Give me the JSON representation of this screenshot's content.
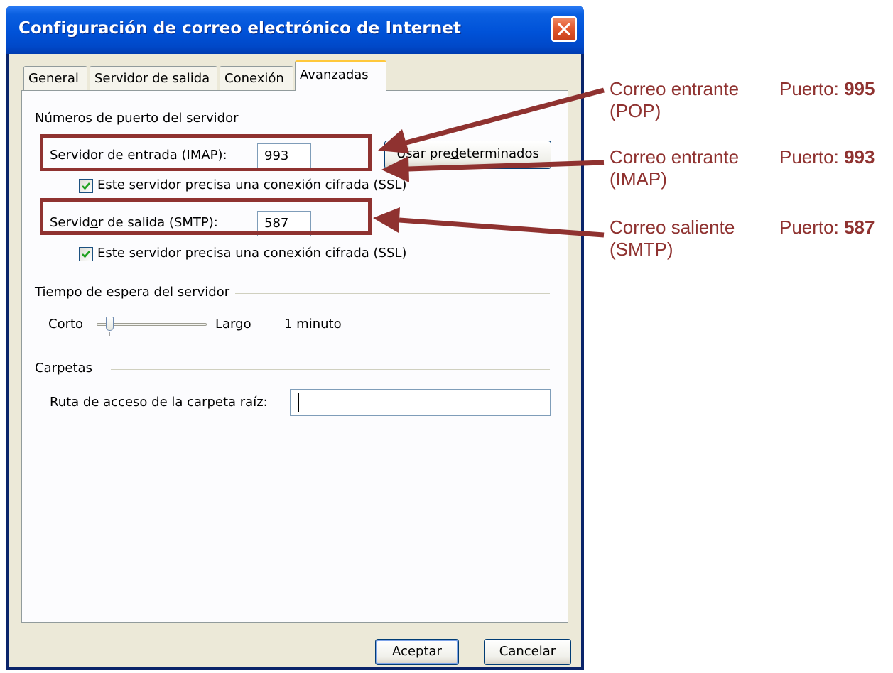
{
  "window": {
    "title": "Configuración de correo electrónico de Internet",
    "close_icon": "close-icon"
  },
  "tabs": [
    {
      "label": "General",
      "active": false
    },
    {
      "label": "Servidor de salida",
      "active": false
    },
    {
      "label": "Conexión",
      "active": false
    },
    {
      "label": "Avanzadas",
      "active": true
    }
  ],
  "ports_section": {
    "title": "Números de puerto del servidor",
    "incoming": {
      "label_pre": "Servi",
      "label_u": "d",
      "label_post": "or de entrada (IMAP):",
      "value": "993"
    },
    "incoming_ssl": {
      "pre": "Este servidor precisa una cone",
      "u": "x",
      "post": "ión cifrada (SSL)",
      "checked": true
    },
    "outgoing": {
      "label_pre": "Servid",
      "label_u": "o",
      "label_post": "r de salida (SMTP):",
      "value": "587"
    },
    "outgoing_ssl": {
      "pre": "E",
      "u": "s",
      "post": "te servidor precisa una conexión cifrada (SSL)",
      "checked": true
    },
    "defaults_button": {
      "pre": "Usar pre",
      "u": "d",
      "post": "eterminados"
    }
  },
  "timeout_section": {
    "title_u": "T",
    "title_rest": "iempo de espera del servidor",
    "short_label": "Corto",
    "long_label": "Largo",
    "value": "1 minuto",
    "level": 0
  },
  "folders_section": {
    "title": "Carpetas",
    "root_label_pre": "R",
    "root_label_u": "u",
    "root_label_post": "ta de acceso de la carpeta raíz:",
    "root_value": ""
  },
  "buttons": {
    "ok": "Aceptar",
    "cancel": "Cancelar"
  },
  "annotations": [
    {
      "line1": "Correo entrante",
      "line2": "(POP)",
      "port_label": "Puerto:",
      "port_value": "995"
    },
    {
      "line1": "Correo entrante",
      "line2": "(IMAP)",
      "port_label": "Puerto:",
      "port_value": "993"
    },
    {
      "line1": "Correo saliente",
      "line2": "(SMTP)",
      "port_label": "Puerto:",
      "port_value": "587"
    }
  ],
  "colors": {
    "annotation": "#8f3230",
    "title_bar": "#0052d8",
    "dialog_bg": "#ece9d8",
    "active_tab_accent": "#ffc83c"
  }
}
